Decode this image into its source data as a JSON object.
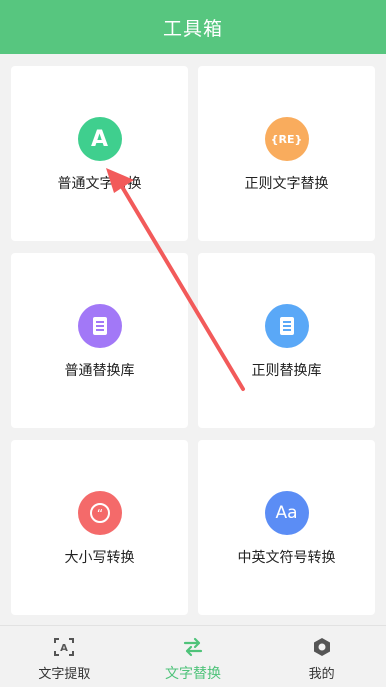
{
  "header": {
    "title": "工具箱"
  },
  "tools": [
    {
      "label": "普通文字替换",
      "icon": "letter-a-icon",
      "color": "#3fcf8e",
      "glyph": "A"
    },
    {
      "label": "正则文字替换",
      "icon": "regex-icon",
      "color": "#f9ac5d",
      "glyph": "{RE}"
    },
    {
      "label": "普通替换库",
      "icon": "book-icon",
      "color": "#a278f7",
      "glyph": ""
    },
    {
      "label": "正则替换库",
      "icon": "book-icon",
      "color": "#5aa8f7",
      "glyph": ""
    },
    {
      "label": "大小写转换",
      "icon": "quote-icon",
      "color": "#f46a6a",
      "glyph": "“"
    },
    {
      "label": "中英文符号转换",
      "icon": "aa-icon",
      "color": "#5b8df5",
      "glyph": "Aa"
    }
  ],
  "tabbar": {
    "items": [
      {
        "label": "文字提取",
        "icon": "text-scan-icon"
      },
      {
        "label": "文字替换",
        "icon": "swap-arrows-icon",
        "active": true
      },
      {
        "label": "我的",
        "icon": "hexagon-settings-icon"
      }
    ]
  },
  "colors": {
    "accent": "#57c67f",
    "active_tab": "#4fc37a",
    "arrow": "#f25a5a"
  }
}
